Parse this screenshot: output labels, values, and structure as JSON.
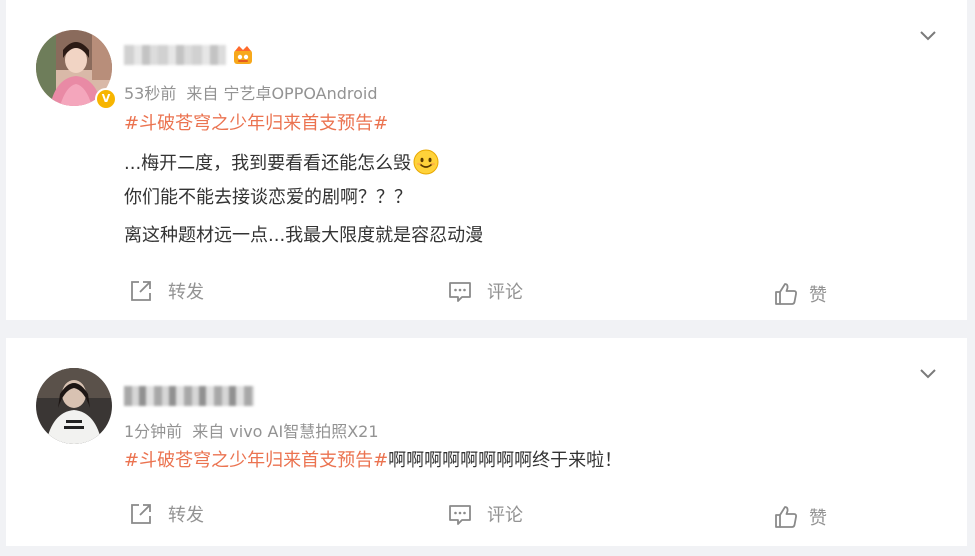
{
  "posts": [
    {
      "time": "53秒前",
      "source": "来自 宁艺卓OPPOAndroid",
      "topic": "#斗破苍穹之少年归来首支预告#",
      "lines": [
        "...梅开二度，我到要看看还能怎么毁",
        "你们能不能去接谈恋爱的剧啊？？？",
        "离这种题材远一点...我最大限度就是容忍动漫"
      ],
      "icons": {
        "verified": "verified-badge-icon",
        "member": "vip-member-icon",
        "emoji": "smile-emoji-icon"
      },
      "verified_label": "V"
    },
    {
      "time": "1分钟前",
      "source": "来自 vivo AI智慧拍照X21",
      "topic": "#斗破苍穹之少年归来首支预告#",
      "text": "啊啊啊啊啊啊啊啊终于来啦！"
    }
  ],
  "actions": {
    "forward": "转发",
    "comment": "评论",
    "like": "赞"
  },
  "colors": {
    "topic": "#eb7350",
    "meta": "#939393",
    "background": "#f1f2f5"
  }
}
